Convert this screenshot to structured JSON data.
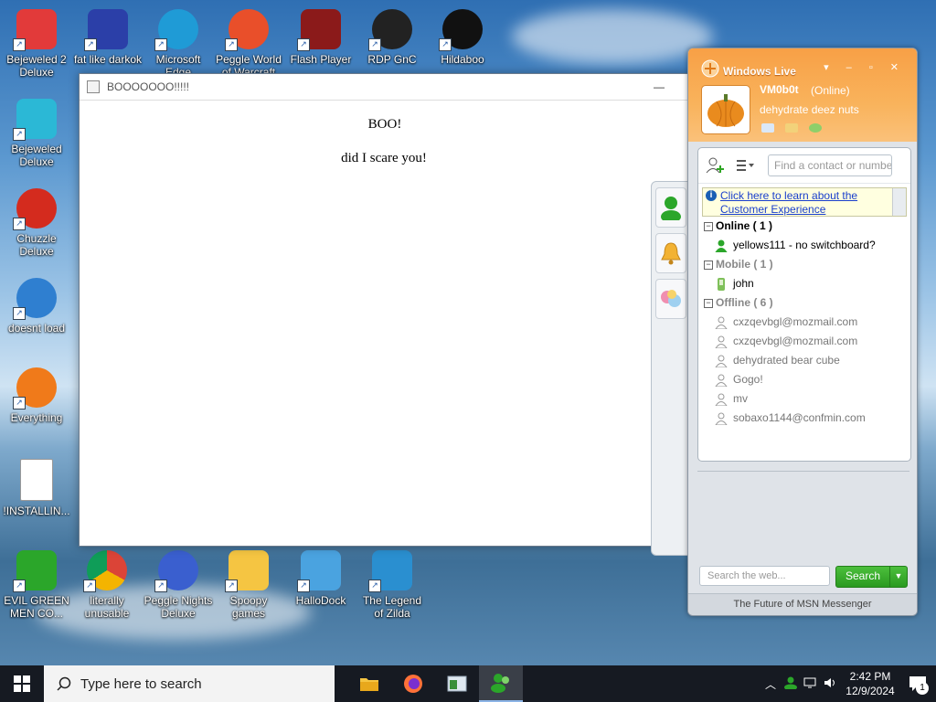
{
  "desktop": {
    "icons_left": [
      {
        "label": "Bejeweled 2\nDeluxe",
        "icon": "bejeweled2-icon"
      },
      {
        "label": "Bejeweled\nDeluxe",
        "icon": "bejeweled-icon"
      },
      {
        "label": "Chuzzle\nDeluxe",
        "icon": "chuzzle-icon"
      },
      {
        "label": "doesnt load",
        "icon": "thunderbird-icon"
      },
      {
        "label": "Everything",
        "icon": "everything-icon"
      },
      {
        "label": "!INSTALLIN...",
        "icon": "document-icon"
      }
    ],
    "icons_top": [
      {
        "label": "fat like darkok",
        "icon": "mpl-icon"
      },
      {
        "label": "Microsoft\nEdge",
        "icon": "edge-icon"
      },
      {
        "label": "Peggle World\nof Warcraft",
        "icon": "peggle-icon"
      },
      {
        "label": "Flash Player",
        "icon": "flash-icon"
      },
      {
        "label": "RDP GnC",
        "icon": "rdp-icon"
      },
      {
        "label": "Hildaboo",
        "icon": "yashma-icon"
      }
    ],
    "icons_bottom": [
      {
        "label": "EVIL GREEN\nMEN CO...",
        "icon": "msn-people-icon"
      },
      {
        "label": "literally\nunusable",
        "icon": "chrome-icon"
      },
      {
        "label": "Peggle Nights\nDeluxe",
        "icon": "peggle-nights-icon"
      },
      {
        "label": "Spoopy\ngames",
        "icon": "folder-icon"
      },
      {
        "label": "HalloDock",
        "icon": "shield-icon"
      },
      {
        "label": "The Legend\nof Zilda",
        "icon": "zilda-icon"
      }
    ]
  },
  "browser_window": {
    "title": "BOOOOOOO!!!!!",
    "heading": "BOO!",
    "text": "did I scare you!",
    "minimize": "—"
  },
  "msn": {
    "brand": "Windows Live",
    "controls": "▾ – ▫ ✕",
    "display_name": "VM0b0t",
    "status": "(Online)",
    "personal_message": "dehydrate deez nuts",
    "search_contacts_placeholder": "Find a contact or number...",
    "banner_link": "Click here to learn about the Customer Experience",
    "groups": [
      {
        "name": "Online ( 1 )",
        "style": "online",
        "contacts": [
          {
            "name": "yellows111 - no switchboard?",
            "state": "online"
          }
        ]
      },
      {
        "name": "Mobile ( 1 )",
        "style": "gray",
        "contacts": [
          {
            "name": "john",
            "state": "mobile"
          }
        ]
      },
      {
        "name": "Offline ( 6 )",
        "style": "gray",
        "contacts": [
          {
            "name": "cxzqevbgl@mozmail.com",
            "state": "offline"
          },
          {
            "name": "cxzqevbgl@mozmail.com",
            "state": "offline"
          },
          {
            "name": "dehydrated bear cube",
            "state": "offline"
          },
          {
            "name": "Gogo!",
            "state": "offline"
          },
          {
            "name": "mv",
            "state": "offline"
          },
          {
            "name": "sobaxo1144@confmin.com",
            "state": "offline"
          }
        ]
      }
    ],
    "web_search_placeholder": "Search the web...",
    "search_button": "Search",
    "footer": "The Future of MSN Messenger"
  },
  "taskbar": {
    "search_placeholder": "Type here to search",
    "time": "2:42 PM",
    "date": "12/9/2024",
    "notification_count": "1"
  },
  "colors": {
    "msn_orange": "#f9a64c",
    "search_green": "#2fa524",
    "taskbar": "#161a22"
  }
}
